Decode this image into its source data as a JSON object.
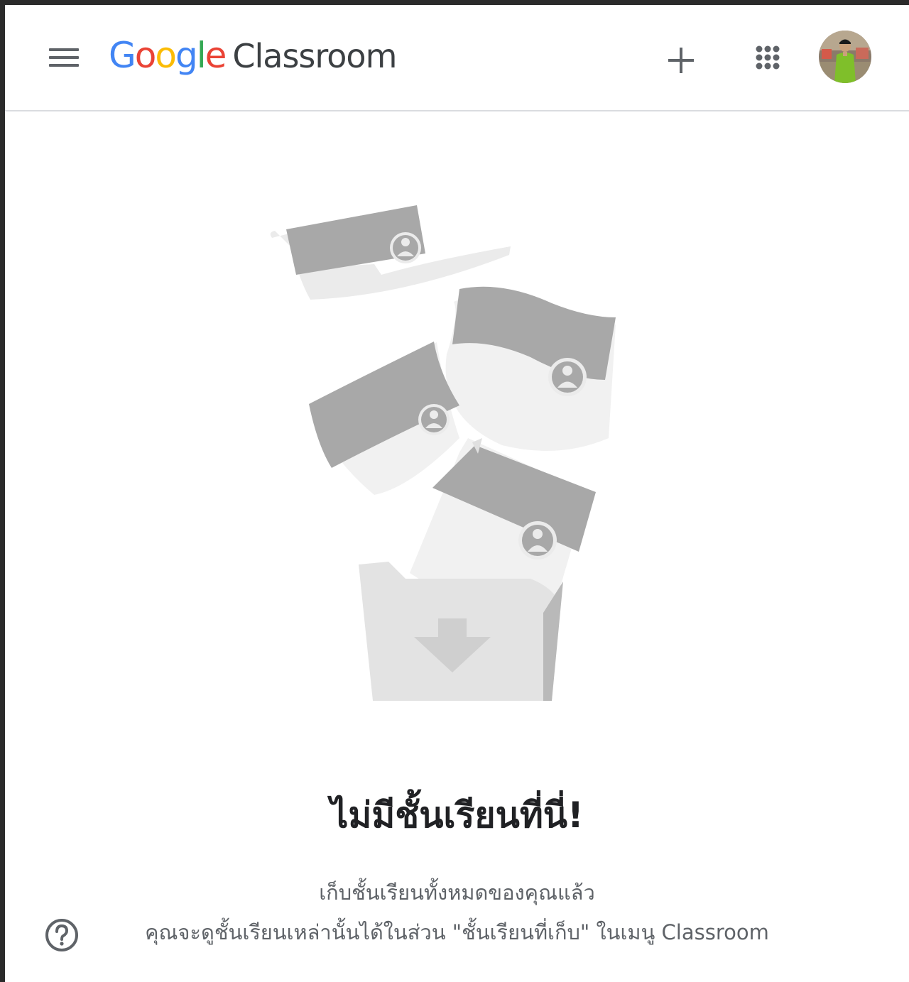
{
  "header": {
    "menu_icon": "hamburger-menu-icon",
    "logo": {
      "letters": [
        {
          "char": "G",
          "color": "#4285F4"
        },
        {
          "char": "o",
          "color": "#EA4335"
        },
        {
          "char": "o",
          "color": "#FBBC05"
        },
        {
          "char": "g",
          "color": "#4285F4"
        },
        {
          "char": "l",
          "color": "#34A853"
        },
        {
          "char": "e",
          "color": "#EA4335"
        }
      ],
      "product": "Classroom"
    },
    "add_icon": "plus-icon",
    "apps_icon": "google-apps-grid-icon",
    "avatar_icon": "user-avatar"
  },
  "main": {
    "illustration_icon": "archived-classes-folder-illustration",
    "title": "ไม่มีชั้นเรียนที่นี่!",
    "description_line1": "เก็บชั้นเรียนทั้งหมดของคุณแล้ว",
    "description_line2": "คุณจะดูชั้นเรียนเหล่านั้นได้ในส่วน \"ชั้นเรียนที่เก็บ\" ในเมนู Classroom"
  },
  "footer": {
    "help_icon": "help-question-icon"
  },
  "colors": {
    "text_primary": "#202124",
    "text_secondary": "#5f6368",
    "divider": "#dadce0",
    "illustration_dark": "#a9a9a9",
    "illustration_light": "#e6e6e6"
  }
}
